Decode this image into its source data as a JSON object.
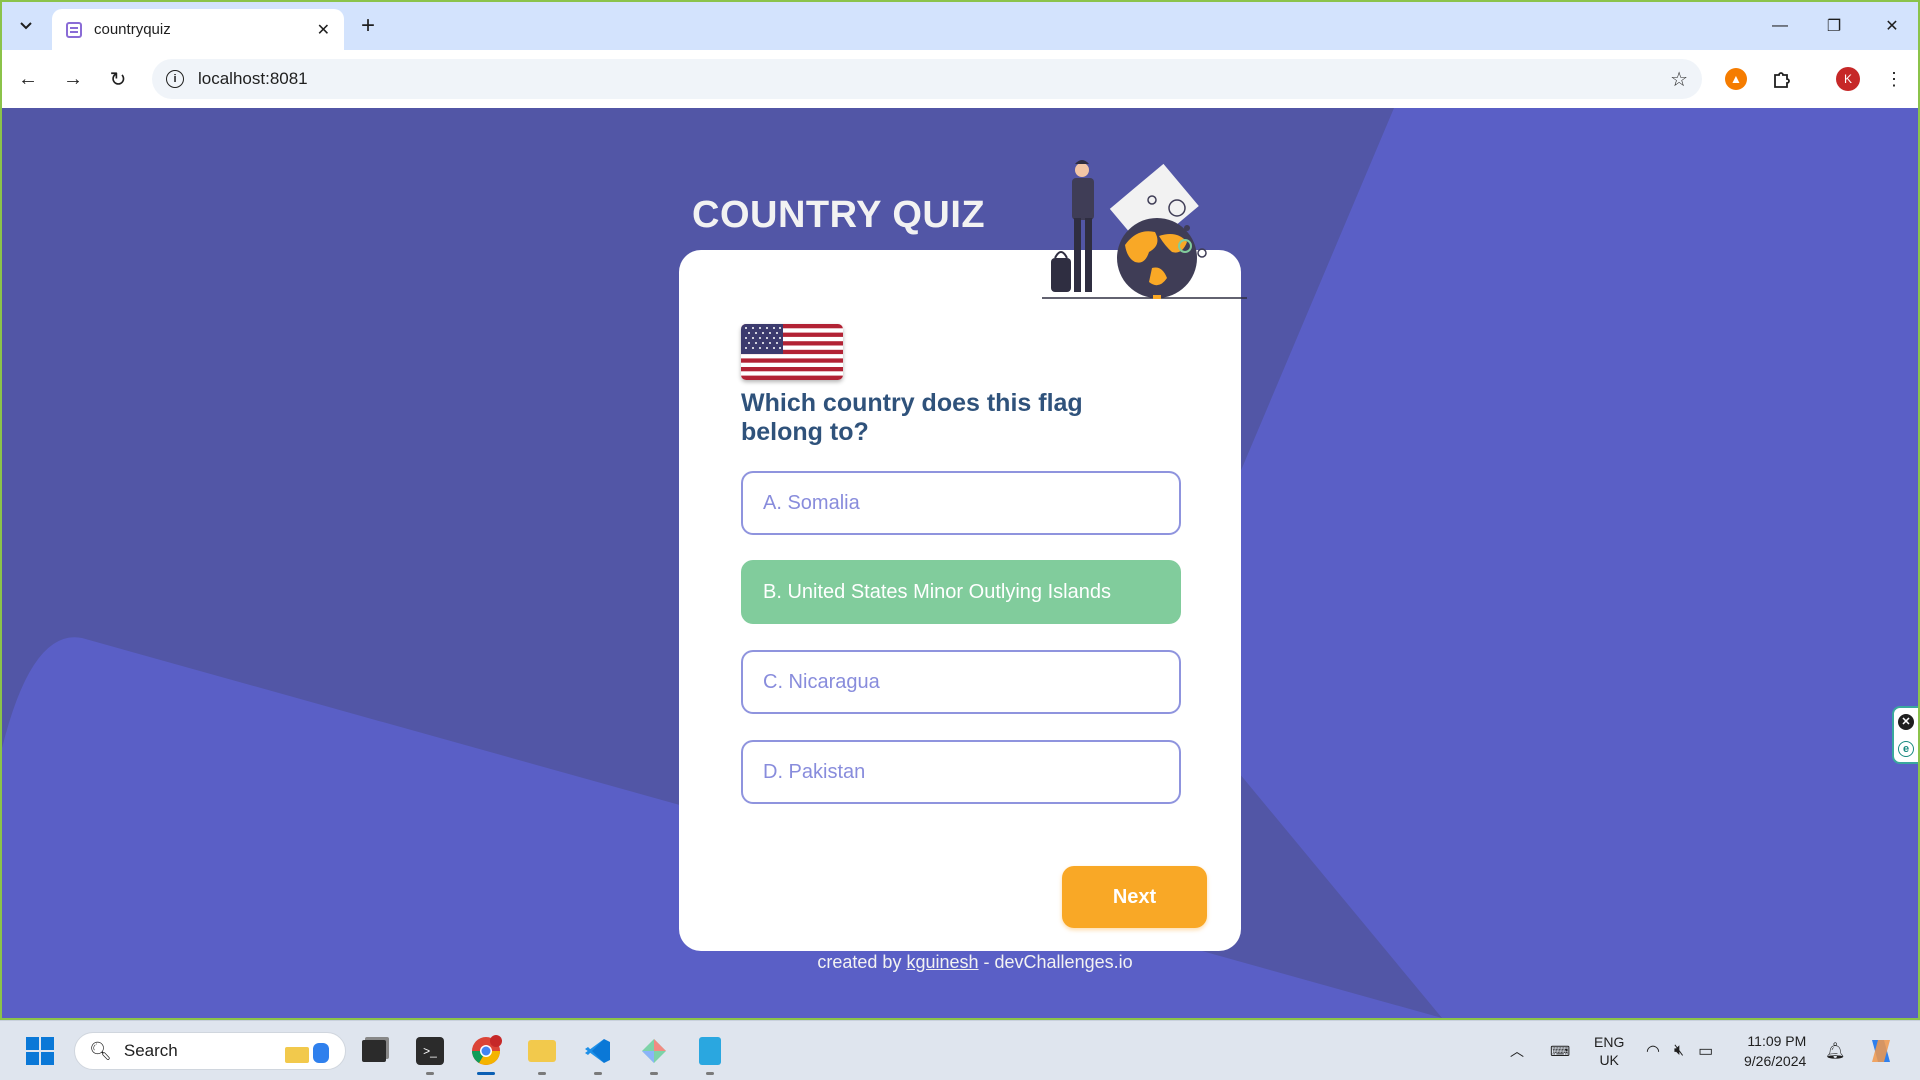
{
  "browser": {
    "tab_title": "countryquiz",
    "url": "localhost:8081",
    "profile_initial": "K"
  },
  "page": {
    "title": "COUNTRY QUIZ",
    "question": "Which country does this flag belong to?",
    "options": [
      {
        "label": "A. Somalia",
        "state": "default"
      },
      {
        "label": "B. United States Minor Outlying Islands",
        "state": "correct"
      },
      {
        "label": "C. Nicaragua",
        "state": "default"
      },
      {
        "label": "D. Pakistan",
        "state": "default"
      }
    ],
    "next_label": "Next",
    "footer": {
      "prefix": "created by ",
      "author": "kguinesh",
      "suffix": " - devChallenges.io"
    },
    "colors": {
      "background": "#5a5fc6",
      "title": "#2f527b",
      "correct": "#81cc9c",
      "accent": "#f9a826"
    }
  },
  "taskbar": {
    "search_placeholder": "Search",
    "lang_line1": "ENG",
    "lang_line2": "UK",
    "time": "11:09 PM",
    "date": "9/26/2024"
  }
}
